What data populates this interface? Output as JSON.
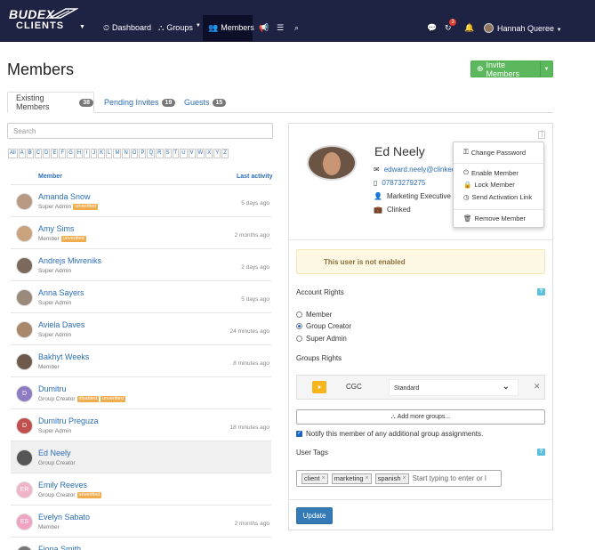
{
  "brand": {
    "line1": "BUDEX",
    "line2": "CLIENTS"
  },
  "nav": {
    "items": [
      {
        "label": "Dashboard",
        "icon": "dashboard-icon"
      },
      {
        "label": "Groups",
        "icon": "sitemap-icon"
      },
      {
        "label": "Members",
        "icon": "users-icon"
      }
    ],
    "notification_count": "3",
    "user_name": "Hannah Queree"
  },
  "page": {
    "title": "Members",
    "invite_label": "Invite Members"
  },
  "tabs": [
    {
      "label": "Existing Members",
      "count": "38"
    },
    {
      "label": "Pending Invites",
      "count": "19"
    },
    {
      "label": "Guests",
      "count": "15"
    }
  ],
  "search": {
    "placeholder": "Search"
  },
  "alphabet": [
    "All",
    "A",
    "B",
    "C",
    "D",
    "E",
    "F",
    "G",
    "H",
    "I",
    "J",
    "K",
    "L",
    "M",
    "N",
    "O",
    "P",
    "Q",
    "R",
    "S",
    "T",
    "U",
    "V",
    "W",
    "X",
    "Y",
    "Z"
  ],
  "list": {
    "col_member": "Member",
    "col_activity": "Last activity",
    "members": [
      {
        "name": "Amanda Snow",
        "role": "Super Admin",
        "tags": [
          "unverified"
        ],
        "activity": "5 days ago",
        "initials": ""
      },
      {
        "name": "Amy Sims",
        "role": "Member",
        "tags": [
          "unverified"
        ],
        "activity": "2 months ago",
        "initials": ""
      },
      {
        "name": "Andrejs Mivreniks",
        "role": "Super Admin",
        "tags": [],
        "activity": "2 days ago",
        "initials": ""
      },
      {
        "name": "Anna Sayers",
        "role": "Super Admin",
        "tags": [],
        "activity": "5 days ago",
        "initials": ""
      },
      {
        "name": "Aviela Daves",
        "role": "Super Admin",
        "tags": [],
        "activity": "24 minutes ago",
        "initials": ""
      },
      {
        "name": "Bakhyt Weeks",
        "role": "Member",
        "tags": [],
        "activity": "8 minutes ago",
        "initials": ""
      },
      {
        "name": "Dumitru",
        "role": "Group Creator",
        "tags": [
          "disabled",
          "unverified"
        ],
        "activity": "",
        "initials": "D"
      },
      {
        "name": "Dumitru Preguza",
        "role": "Super Admin",
        "tags": [],
        "activity": "18 minutes ago",
        "initials": "D"
      },
      {
        "name": "Ed Neely",
        "role": "Group Creator",
        "tags": [],
        "activity": "",
        "initials": ""
      },
      {
        "name": "Emily Reeves",
        "role": "Group Creator",
        "tags": [
          "unverified"
        ],
        "activity": "",
        "initials": "ER"
      },
      {
        "name": "Evelyn Sabato",
        "role": "Member",
        "tags": [],
        "activity": "2 months ago",
        "initials": "ES"
      },
      {
        "name": "Fiona Smith",
        "role": "",
        "tags": [],
        "activity": "",
        "initials": ""
      }
    ]
  },
  "detail": {
    "name": "Ed Neely",
    "email": "edward.neely@clinked",
    "phone": "07873279275",
    "job": "Marketing Executive",
    "company": "Clinked",
    "warning": "This user is not enabled",
    "account_rights_label": "Account Rights",
    "rights": [
      {
        "label": "Member",
        "checked": false
      },
      {
        "label": "Group Creator",
        "checked": true
      },
      {
        "label": "Super Admin",
        "checked": false
      }
    ],
    "groups_rights_label": "Groups Rights",
    "group": {
      "name": "CGC",
      "permission": "Standard"
    },
    "add_groups_label": "Add more groups...",
    "notify_label": "Notify this member of any additional group assignments.",
    "user_tags_label": "User Tags",
    "tags": [
      "client",
      "marketing",
      "spanish"
    ],
    "tags_placeholder": "Start typing to enter or l",
    "help_label": "?",
    "update_label": "Update"
  },
  "menu": {
    "change_password": "Change Password",
    "enable_member": "Enable Member",
    "lock_member": "Lock Member",
    "send_activation": "Send Activation Link",
    "remove_member": "Remove Member"
  }
}
